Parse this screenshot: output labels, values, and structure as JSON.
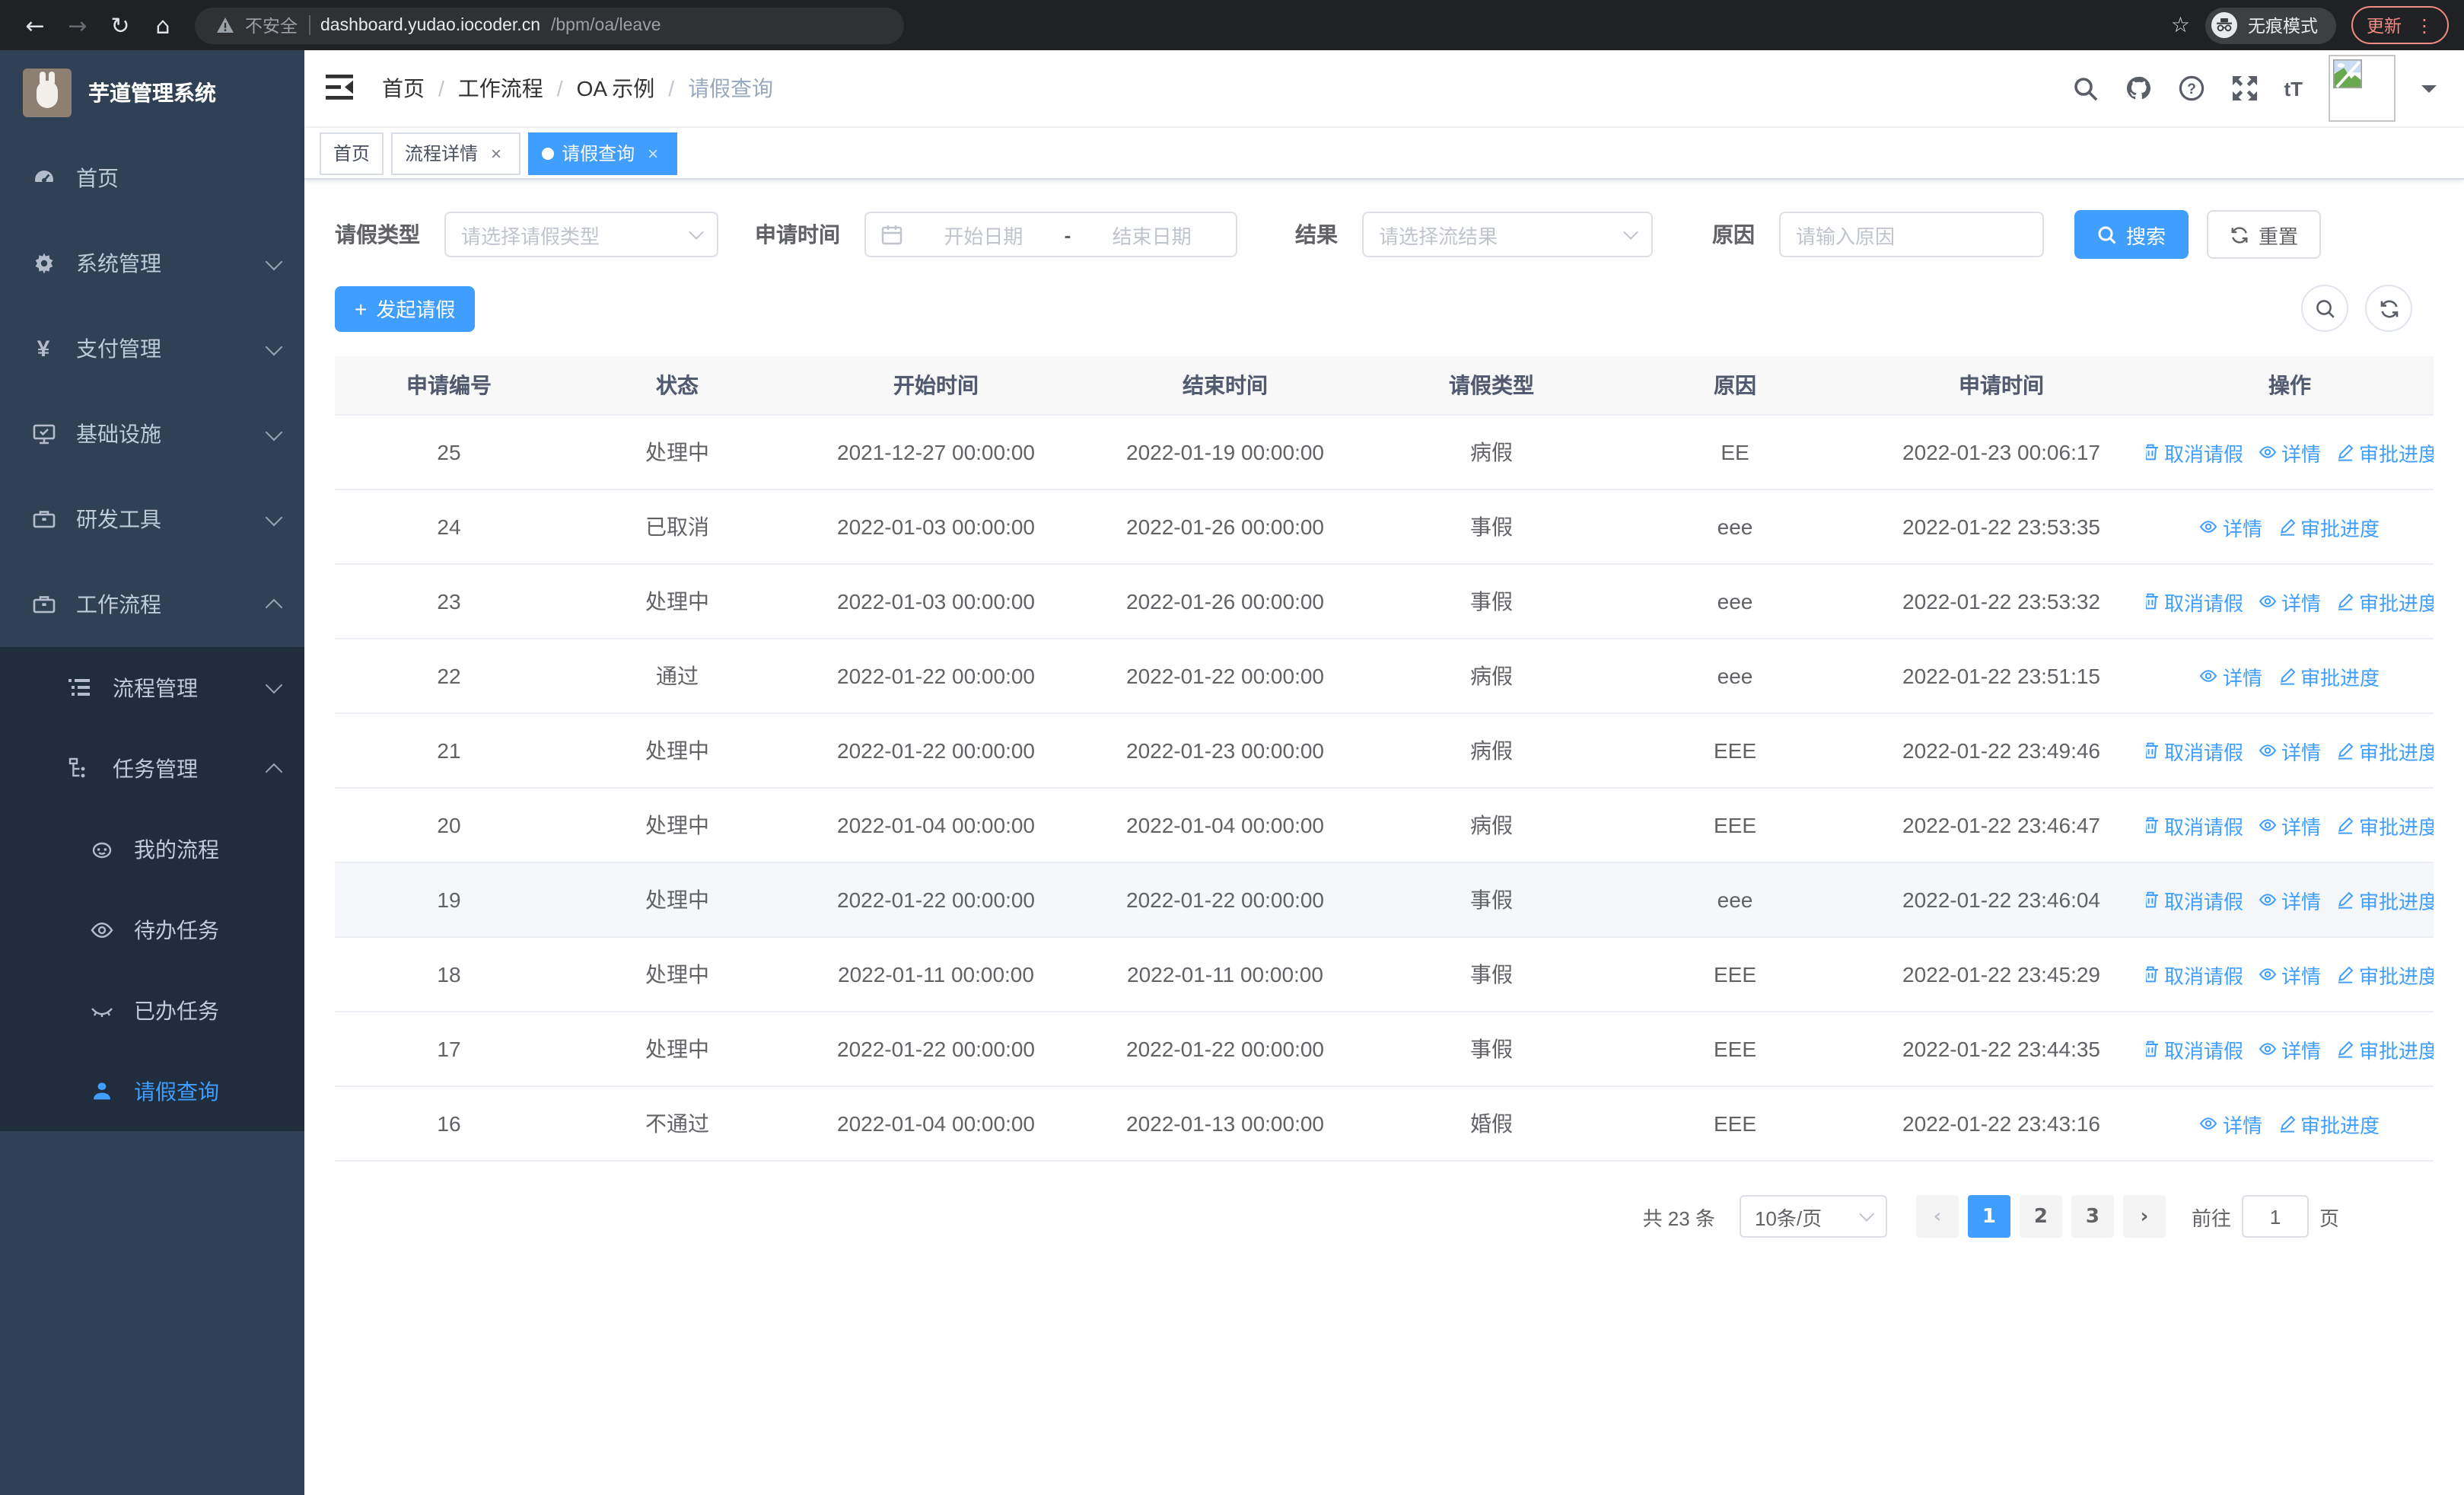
{
  "colors": {
    "accent": "#409eff",
    "sidebar_bg": "#304156",
    "submenu_bg": "#1f2d3d",
    "danger_chip": "#f28b82"
  },
  "browser": {
    "security_label": "不安全",
    "url_host": "dashboard.yudao.iocoder.cn",
    "url_path": "/bpm/oa/leave",
    "incognito_label": "无痕模式",
    "update_label": "更新"
  },
  "sidebar": {
    "app_title": "芋道管理系统",
    "menu": [
      {
        "label": "首页"
      },
      {
        "label": "系统管理"
      },
      {
        "label": "支付管理"
      },
      {
        "label": "基础设施"
      },
      {
        "label": "研发工具"
      },
      {
        "label": "工作流程"
      }
    ],
    "workflow_submenu": [
      {
        "label": "流程管理"
      },
      {
        "label": "任务管理"
      },
      {
        "label": "我的流程"
      },
      {
        "label": "待办任务"
      },
      {
        "label": "已办任务"
      },
      {
        "label": "请假查询"
      }
    ]
  },
  "navbar": {
    "breadcrumb": [
      "首页",
      "工作流程",
      "OA 示例",
      "请假查询"
    ],
    "font_size_label": "tT"
  },
  "tabs": [
    {
      "label": "首页",
      "closable": false,
      "active": false
    },
    {
      "label": "流程详情",
      "closable": true,
      "active": false
    },
    {
      "label": "请假查询",
      "closable": true,
      "active": true
    }
  ],
  "filters": {
    "leave_type": {
      "label": "请假类型",
      "placeholder": "请选择请假类型"
    },
    "apply_time": {
      "label": "申请时间",
      "start_placeholder": "开始日期",
      "separator": "-",
      "end_placeholder": "结束日期"
    },
    "result": {
      "label": "结果",
      "placeholder": "请选择流结果"
    },
    "reason": {
      "label": "原因",
      "placeholder": "请输入原因"
    },
    "search_label": "搜索",
    "reset_label": "重置"
  },
  "toolbar": {
    "create_label": "发起请假"
  },
  "table": {
    "headers": [
      "申请编号",
      "状态",
      "开始时间",
      "结束时间",
      "请假类型",
      "原因",
      "申请时间",
      "操作"
    ],
    "action_labels": {
      "cancel": "取消请假",
      "detail": "详情",
      "progress": "审批进度"
    },
    "rows": [
      {
        "id": "25",
        "status": "处理中",
        "start": "2021-12-27 00:00:00",
        "end": "2022-01-19 00:00:00",
        "type": "病假",
        "reason": "EE",
        "applied": "2022-01-23 00:06:17",
        "actions": [
          "cancel",
          "detail",
          "progress"
        ],
        "highlight": false
      },
      {
        "id": "24",
        "status": "已取消",
        "start": "2022-01-03 00:00:00",
        "end": "2022-01-26 00:00:00",
        "type": "事假",
        "reason": "eee",
        "applied": "2022-01-22 23:53:35",
        "actions": [
          "detail",
          "progress"
        ],
        "highlight": false
      },
      {
        "id": "23",
        "status": "处理中",
        "start": "2022-01-03 00:00:00",
        "end": "2022-01-26 00:00:00",
        "type": "事假",
        "reason": "eee",
        "applied": "2022-01-22 23:53:32",
        "actions": [
          "cancel",
          "detail",
          "progress"
        ],
        "highlight": false
      },
      {
        "id": "22",
        "status": "通过",
        "start": "2022-01-22 00:00:00",
        "end": "2022-01-22 00:00:00",
        "type": "病假",
        "reason": "eee",
        "applied": "2022-01-22 23:51:15",
        "actions": [
          "detail",
          "progress"
        ],
        "highlight": false
      },
      {
        "id": "21",
        "status": "处理中",
        "start": "2022-01-22 00:00:00",
        "end": "2022-01-23 00:00:00",
        "type": "病假",
        "reason": "EEE",
        "applied": "2022-01-22 23:49:46",
        "actions": [
          "cancel",
          "detail",
          "progress"
        ],
        "highlight": false
      },
      {
        "id": "20",
        "status": "处理中",
        "start": "2022-01-04 00:00:00",
        "end": "2022-01-04 00:00:00",
        "type": "病假",
        "reason": "EEE",
        "applied": "2022-01-22 23:46:47",
        "actions": [
          "cancel",
          "detail",
          "progress"
        ],
        "highlight": false
      },
      {
        "id": "19",
        "status": "处理中",
        "start": "2022-01-22 00:00:00",
        "end": "2022-01-22 00:00:00",
        "type": "事假",
        "reason": "eee",
        "applied": "2022-01-22 23:46:04",
        "actions": [
          "cancel",
          "detail",
          "progress"
        ],
        "highlight": true
      },
      {
        "id": "18",
        "status": "处理中",
        "start": "2022-01-11 00:00:00",
        "end": "2022-01-11 00:00:00",
        "type": "事假",
        "reason": "EEE",
        "applied": "2022-01-22 23:45:29",
        "actions": [
          "cancel",
          "detail",
          "progress"
        ],
        "highlight": false
      },
      {
        "id": "17",
        "status": "处理中",
        "start": "2022-01-22 00:00:00",
        "end": "2022-01-22 00:00:00",
        "type": "事假",
        "reason": "EEE",
        "applied": "2022-01-22 23:44:35",
        "actions": [
          "cancel",
          "detail",
          "progress"
        ],
        "highlight": false
      },
      {
        "id": "16",
        "status": "不通过",
        "start": "2022-01-04 00:00:00",
        "end": "2022-01-13 00:00:00",
        "type": "婚假",
        "reason": "EEE",
        "applied": "2022-01-22 23:43:16",
        "actions": [
          "detail",
          "progress"
        ],
        "highlight": false
      }
    ]
  },
  "pagination": {
    "total_label": "共 23 条",
    "page_size_label": "10条/页",
    "pages": [
      "1",
      "2",
      "3"
    ],
    "active_page": "1",
    "prev_symbol": "‹",
    "next_symbol": "›",
    "goto_label": "前往",
    "goto_value": "1",
    "unit_label": "页"
  }
}
